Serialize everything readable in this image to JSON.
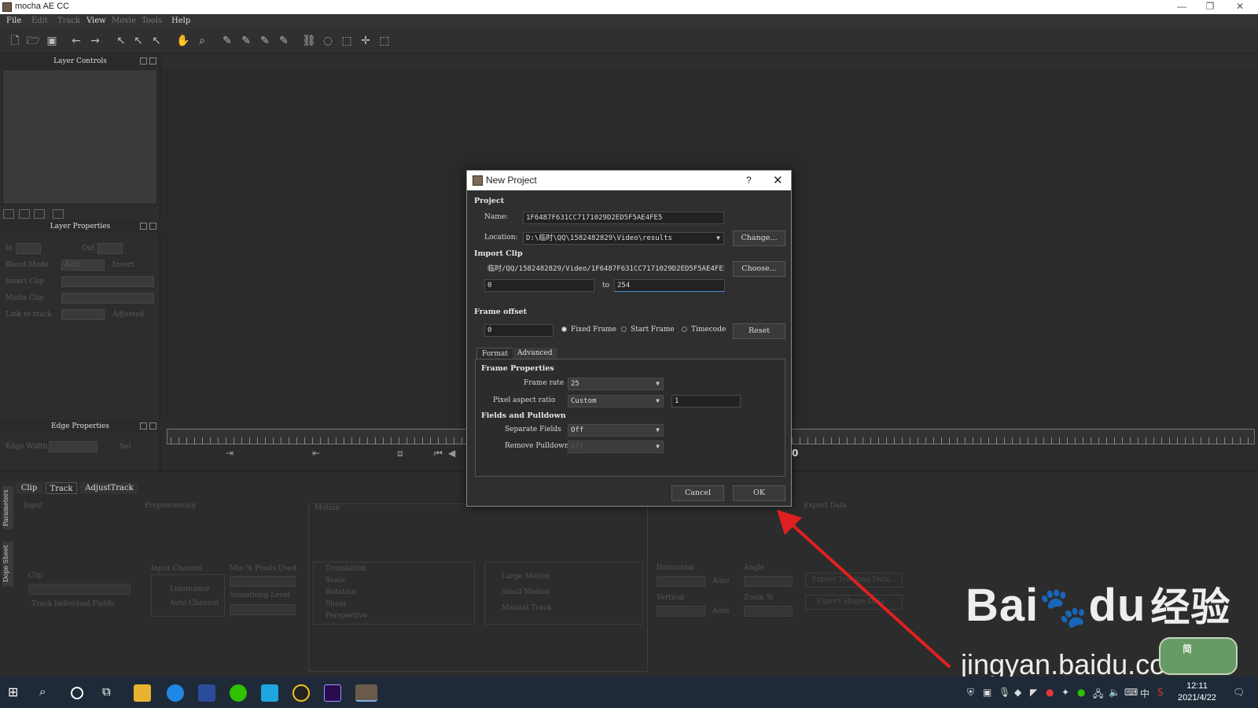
{
  "window": {
    "title": "mocha AE CC"
  },
  "menu": {
    "items": [
      "File",
      "Edit",
      "Track",
      "View",
      "Movie",
      "Tools",
      "Help"
    ]
  },
  "left_panels": {
    "layer_controls": "Layer Controls",
    "layer_properties": "Layer Properties",
    "edge_properties": "Edge Properties",
    "in_label": "In",
    "out_label": "Out",
    "blend_mode": "Blend Mode",
    "blend_value": "Add",
    "invert": "Invert",
    "insert_clip": "Insert Clip",
    "matte_clip": "Matte Clip",
    "link_to_track": "Link to track",
    "adjusted": "Adjusted",
    "edge_width": "Edge Width",
    "set_label": "Set"
  },
  "timeline": {
    "current_frame": "0"
  },
  "bottom": {
    "side_tabs": [
      "Parameters",
      "Dope Sheet"
    ],
    "tabs": [
      "Clip",
      "Track",
      "AdjustTrack"
    ],
    "input": "Input",
    "preprocessing": "Preprocessing",
    "motion": "Motion",
    "export_data": "Export Data",
    "clip": "Clip",
    "track_individual_fields": "Track Individual Fields",
    "input_channel": "Input Channel",
    "luminance": "Luminance",
    "auto_channel": "Auto Channel",
    "min_pixels_used": "Min % Pixels Used",
    "smoothing_level": "Smoothing Level",
    "motion_options": [
      "Translation",
      "Scale",
      "Rotation",
      "Shear",
      "Perspective"
    ],
    "motion_types": [
      "Large Motion",
      "Small Motion",
      "Manual Track"
    ],
    "horizontal": "Horizontal",
    "vertical": "Vertical",
    "auto": "Auto",
    "angle": "Angle",
    "zoom": "Zoom %",
    "export_tracking": "Export Tracking Data...",
    "export_shape": "Export Shape Data..."
  },
  "dialog": {
    "title": "New Project",
    "help": "?",
    "project_section": "Project",
    "name_label": "Name:",
    "name_value": "1F6487F631CC7171029D2ED5F5AE4FE5",
    "location_label": "Location:",
    "location_value": "D:\\临时\\QQ\\1582482829\\Video\\results",
    "change_button": "Change...",
    "import_section": "Import Clip",
    "clip_path": "临时/QQ/1582482829/Video/1F6487F631CC7171029D2ED5F5AE4FE5.mp4",
    "choose_button": "Choose...",
    "range_start": "0",
    "range_to": "to",
    "range_end": "254",
    "frame_offset_section": "Frame offset",
    "frame_offset_value": "0",
    "radio_fixed": "Fixed Frame",
    "radio_start": "Start Frame",
    "radio_timecode": "Timecode",
    "reset_button": "Reset",
    "tab_format": "Format",
    "tab_advanced": "Advanced",
    "frame_properties": "Frame Properties",
    "frame_rate_label": "Frame rate",
    "frame_rate_value": "25",
    "pixel_aspect_label": "Pixel aspect ratio",
    "pixel_aspect_value": "Custom",
    "pixel_aspect_number": "1",
    "fields_section": "Fields and Pulldown",
    "separate_fields_label": "Separate Fields",
    "separate_fields_value": "Off",
    "remove_pulldown_label": "Remove Pulldown",
    "remove_pulldown_value": "Off",
    "cancel_button": "Cancel",
    "ok_button": "OK"
  },
  "watermark": {
    "brand": "Bai",
    "brand2": "du",
    "brand_cn": "经验",
    "url": "jingyan.baidu.com",
    "badge": "简"
  },
  "taskbar": {
    "time": "12:11",
    "date": "2021/4/22",
    "ime": "中"
  },
  "colors": {
    "accent_red": "#e02020",
    "dialog_bg": "#2f2f2f",
    "taskbar": "#1e2a38"
  }
}
